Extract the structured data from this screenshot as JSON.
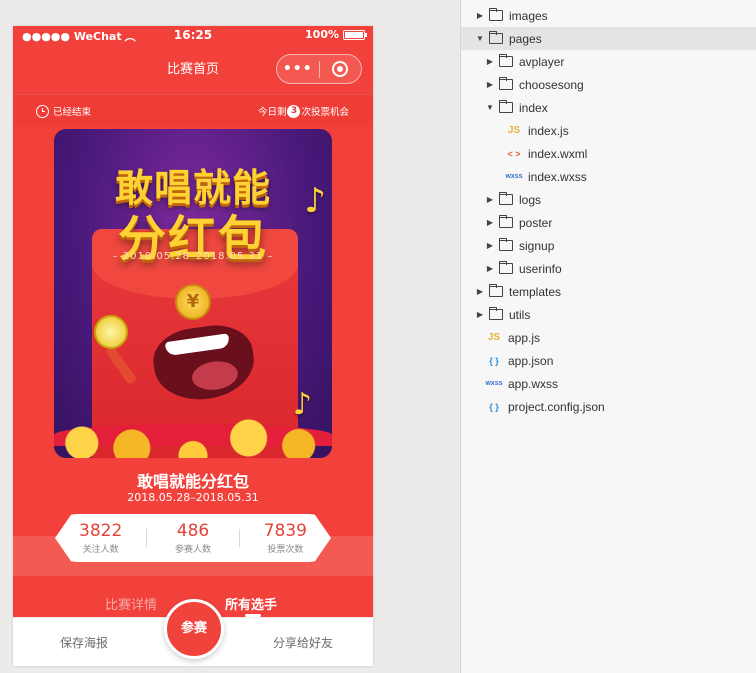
{
  "status_bar": {
    "carrier": "●●●●● WeChat",
    "time": "16:25",
    "battery": "100%",
    "battery_level": 1.0
  },
  "nav": {
    "title": "比赛首页",
    "more": "•••"
  },
  "info": {
    "ended": "已经结束",
    "votes_prefix": "今日剩",
    "votes_count": "3",
    "votes_suffix": "次投票机会"
  },
  "poster": {
    "line1": "敢唱就能",
    "line2": "分红包",
    "dates": "– 2018.05.28–2018.05.31 –",
    "coin": "¥",
    "note_icon": "music-note-icon"
  },
  "contest": {
    "title": "敢唱就能分红包",
    "dates": "2018.05.28–2018.05.31"
  },
  "stats": [
    {
      "value": "3822",
      "label": "关注人数"
    },
    {
      "value": "486",
      "label": "参赛人数"
    },
    {
      "value": "7839",
      "label": "投票次数"
    }
  ],
  "tabs": {
    "details": "比赛详情",
    "players": "所有选手"
  },
  "bottom": {
    "save_poster": "保存海报",
    "join": "参赛",
    "share": "分享给好友"
  },
  "colors": {
    "theme_red": "#f2413a",
    "poster_purple": "#4c1a7d",
    "gold": "#ffd233"
  },
  "file_tree": [
    {
      "name": "images",
      "type": "folder",
      "expanded": false
    },
    {
      "name": "pages",
      "type": "folder",
      "expanded": true,
      "selected": true
    },
    {
      "name": "avplayer",
      "type": "folder",
      "expanded": false
    },
    {
      "name": "choosesong",
      "type": "folder",
      "expanded": false
    },
    {
      "name": "index",
      "type": "folder",
      "expanded": true
    },
    {
      "name": "index.js",
      "type": "js",
      "badge": "JS"
    },
    {
      "name": "index.wxml",
      "type": "wxml",
      "badge": "< >"
    },
    {
      "name": "index.wxss",
      "type": "wxss",
      "badge": "wxss"
    },
    {
      "name": "logs",
      "type": "folder",
      "expanded": false
    },
    {
      "name": "poster",
      "type": "folder",
      "expanded": false
    },
    {
      "name": "signup",
      "type": "folder",
      "expanded": false
    },
    {
      "name": "userinfo",
      "type": "folder",
      "expanded": false
    },
    {
      "name": "templates",
      "type": "folder",
      "expanded": false
    },
    {
      "name": "utils",
      "type": "folder",
      "expanded": false
    },
    {
      "name": "app.js",
      "type": "js",
      "badge": "JS"
    },
    {
      "name": "app.json",
      "type": "json",
      "badge": "{ }"
    },
    {
      "name": "app.wxss",
      "type": "wxss",
      "badge": "wxss"
    },
    {
      "name": "project.config.json",
      "type": "json",
      "badge": "{ }"
    }
  ]
}
